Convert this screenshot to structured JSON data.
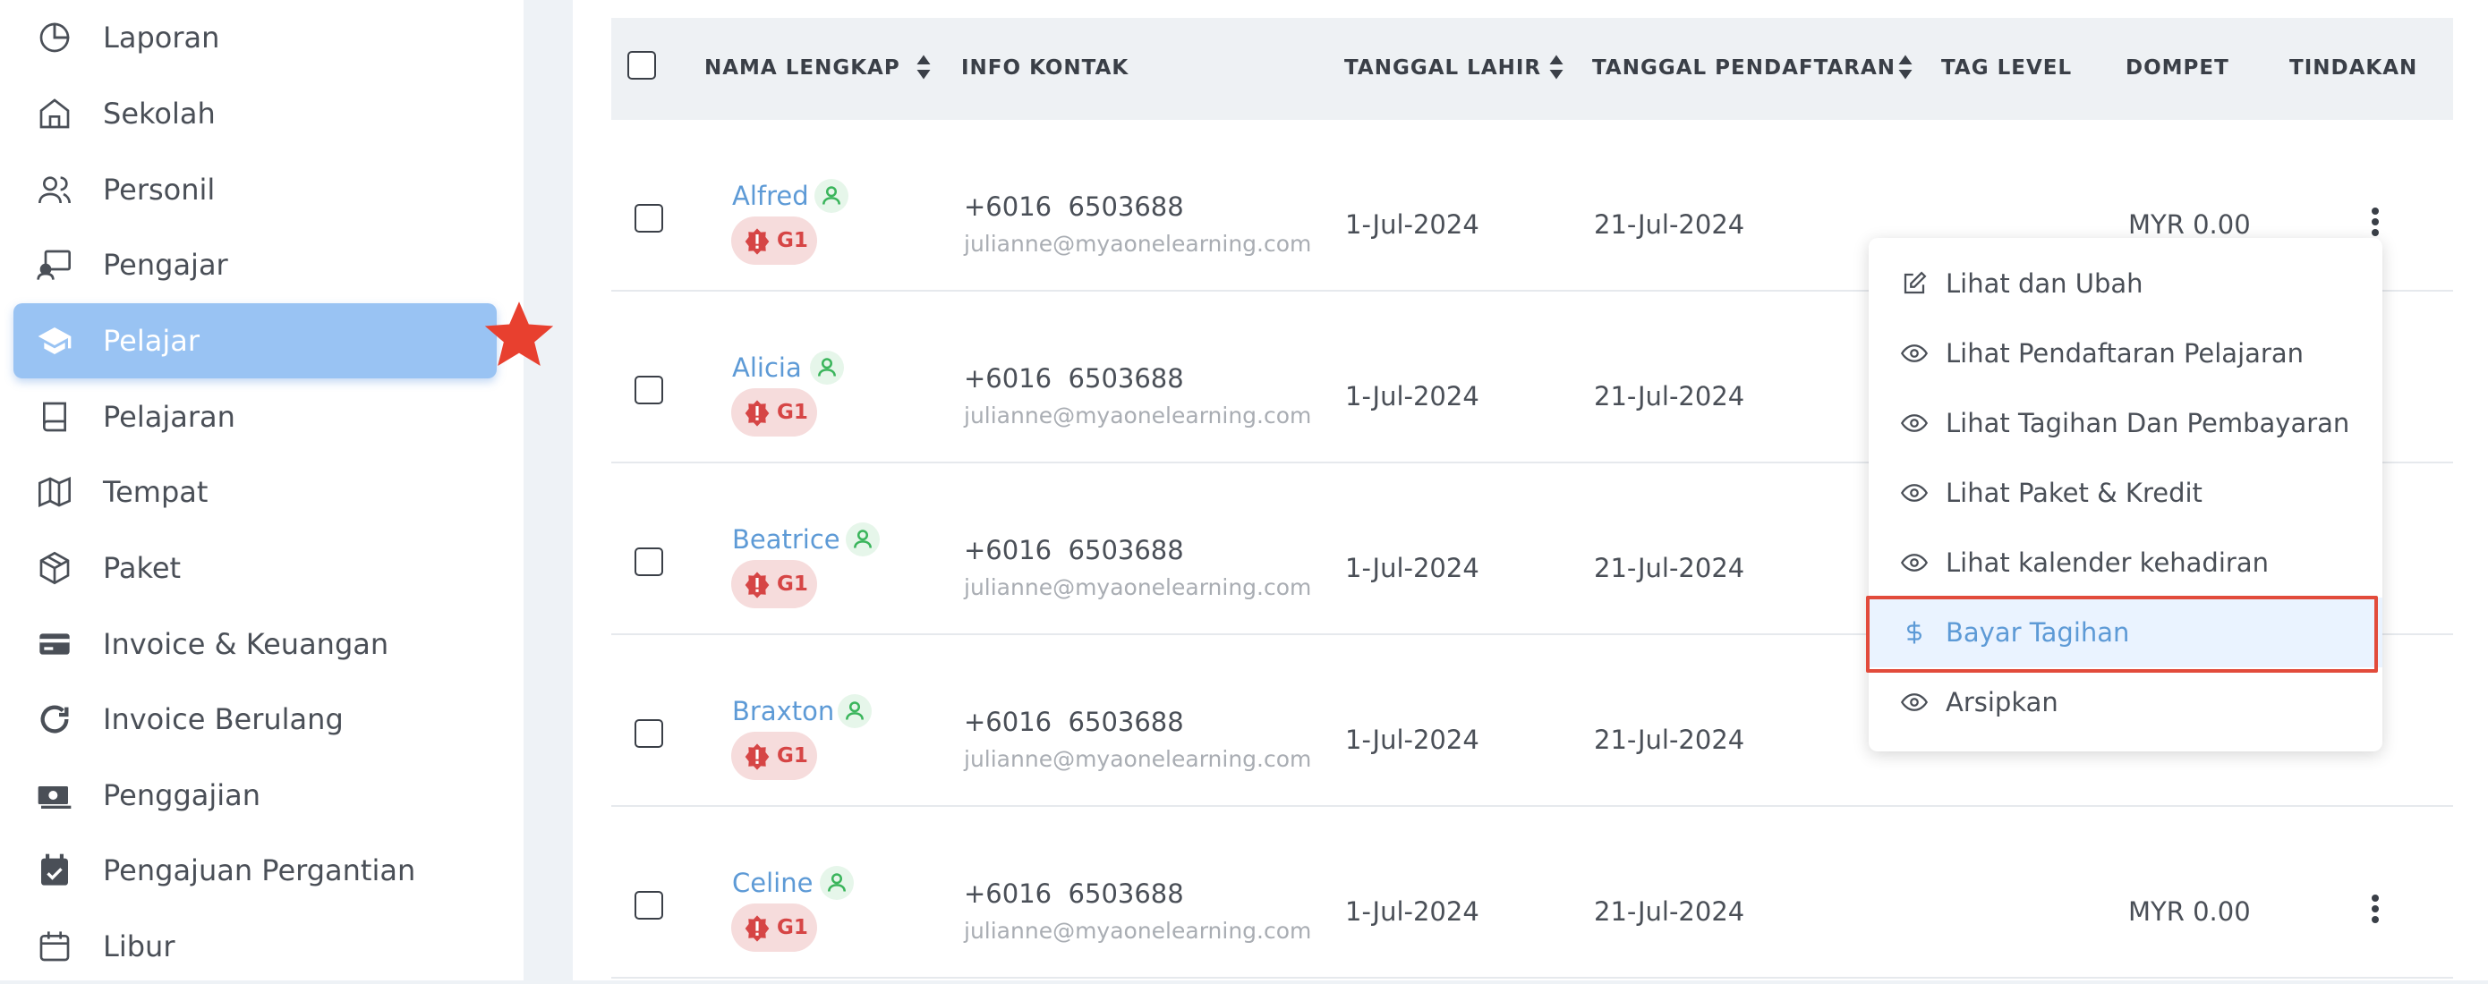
{
  "sidebar": {
    "items": [
      {
        "label": "Laporan",
        "icon": "pie-chart-icon"
      },
      {
        "label": "Sekolah",
        "icon": "home-icon"
      },
      {
        "label": "Personil",
        "icon": "users-icon"
      },
      {
        "label": "Pengajar",
        "icon": "teacher-board-icon"
      },
      {
        "label": "Pelajar",
        "icon": "graduation-cap-icon",
        "active": true
      },
      {
        "label": "Pelajaran",
        "icon": "book-icon"
      },
      {
        "label": "Tempat",
        "icon": "map-icon"
      },
      {
        "label": "Paket",
        "icon": "package-icon"
      },
      {
        "label": "Invoice & Keuangan",
        "icon": "credit-card-icon"
      },
      {
        "label": "Invoice Berulang",
        "icon": "refresh-icon"
      },
      {
        "label": "Penggajian",
        "icon": "money-icon"
      },
      {
        "label": "Pengajuan Pergantian",
        "icon": "calendar-check-icon"
      },
      {
        "label": "Libur",
        "icon": "calendar-icon"
      }
    ]
  },
  "table": {
    "columns": {
      "name": "NAMA LENGKAP",
      "contact": "INFO KONTAK",
      "dob": "TANGGAL LAHIR",
      "reg": "TANGGAL PENDAFTARAN",
      "tag": "TAG LEVEL",
      "wallet": "DOMPET",
      "actions": "TINDAKAN"
    },
    "rows": [
      {
        "name": "Alfred",
        "badge": "G1",
        "phone": "+6016  6503688",
        "email": "julianne@myaonelearning.com",
        "dob": "1-Jul-2024",
        "reg": "21-Jul-2024",
        "wallet": "MYR 0.00"
      },
      {
        "name": "Alicia",
        "badge": "G1",
        "phone": "+6016  6503688",
        "email": "julianne@myaonelearning.com",
        "dob": "1-Jul-2024",
        "reg": "21-Jul-2024",
        "wallet": ""
      },
      {
        "name": "Beatrice",
        "badge": "G1",
        "phone": "+6016  6503688",
        "email": "julianne@myaonelearning.com",
        "dob": "1-Jul-2024",
        "reg": "21-Jul-2024",
        "wallet": ""
      },
      {
        "name": "Braxton",
        "badge": "G1",
        "phone": "+6016  6503688",
        "email": "julianne@myaonelearning.com",
        "dob": "1-Jul-2024",
        "reg": "21-Jul-2024",
        "wallet": ""
      },
      {
        "name": "Celine",
        "badge": "G1",
        "phone": "+6016  6503688",
        "email": "julianne@myaonelearning.com",
        "dob": "1-Jul-2024",
        "reg": "21-Jul-2024",
        "wallet": "MYR 0.00"
      }
    ]
  },
  "menu": {
    "items": [
      {
        "label": "Lihat dan Ubah",
        "icon": "edit-icon"
      },
      {
        "label": "Lihat Pendaftaran Pelajaran",
        "icon": "eye-icon"
      },
      {
        "label": "Lihat Tagihan Dan Pembayaran",
        "icon": "eye-icon"
      },
      {
        "label": "Lihat Paket & Kredit",
        "icon": "eye-icon"
      },
      {
        "label": "Lihat kalender kehadiran",
        "icon": "eye-icon"
      },
      {
        "label": "Bayar Tagihan",
        "icon": "dollar-icon",
        "highlighted": true
      },
      {
        "label": "Arsipkan",
        "icon": "eye-icon"
      }
    ]
  },
  "colors": {
    "accent": "#5d9ad6",
    "active_nav": "#99c3f3",
    "highlight_box": "#e24b3b",
    "badge_bg": "#f6dcdc",
    "badge_text": "#d64545"
  }
}
